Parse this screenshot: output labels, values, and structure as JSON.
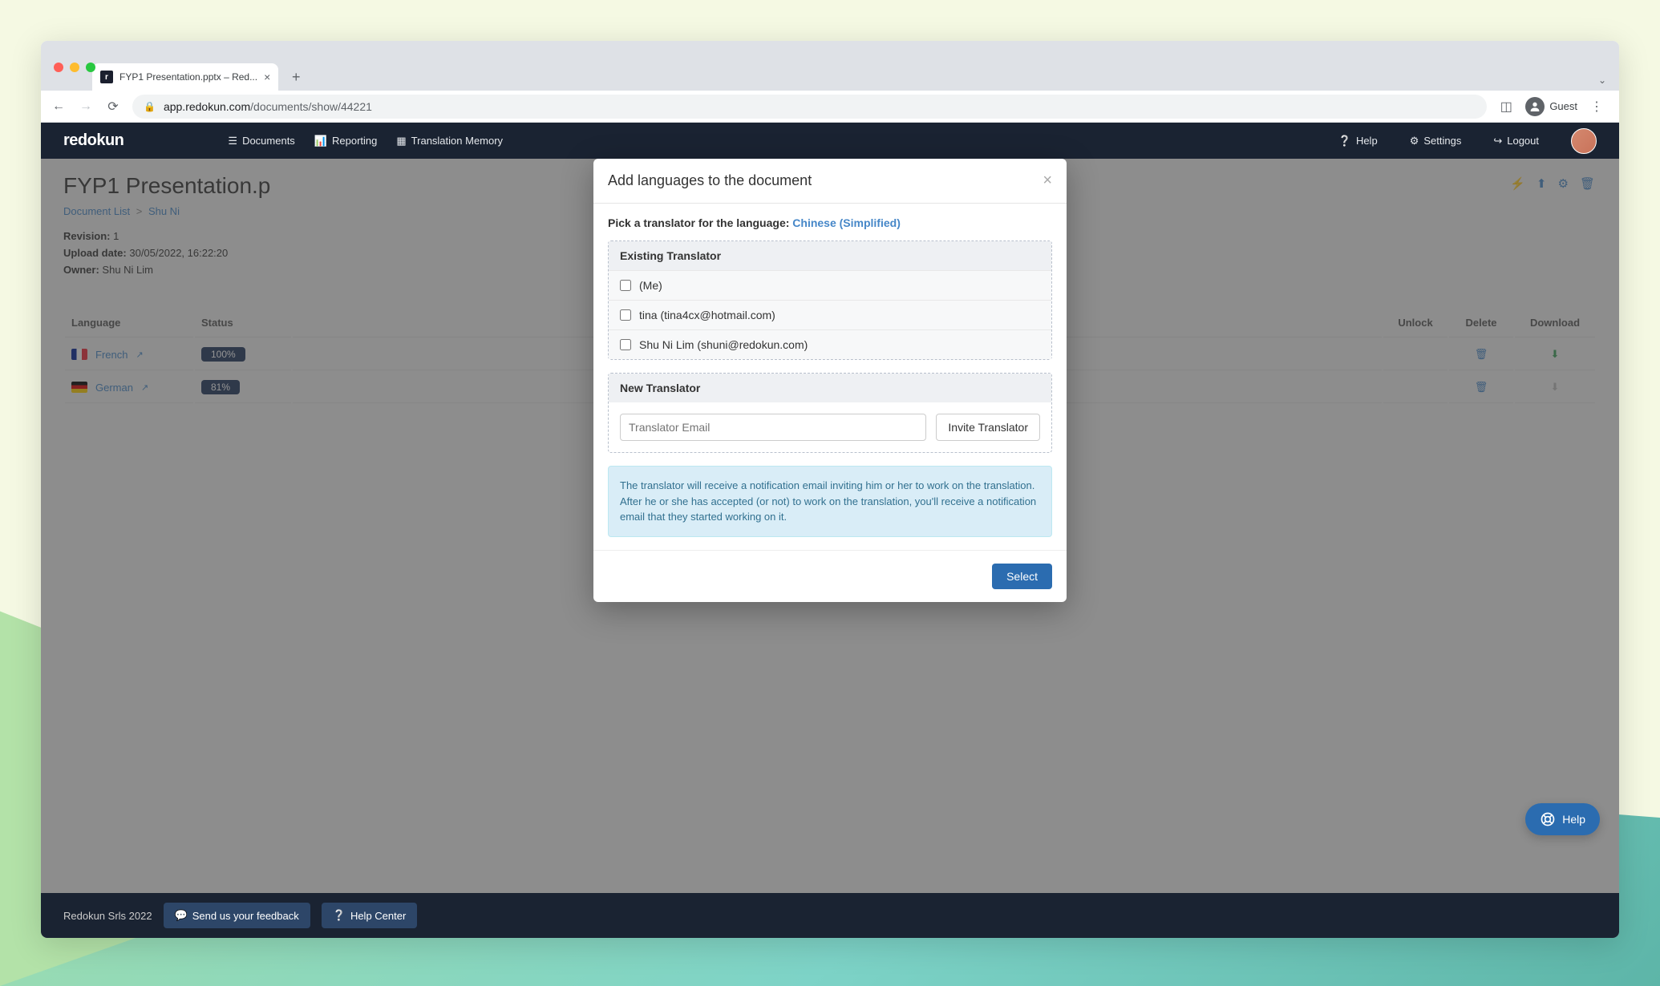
{
  "browser": {
    "tab_title": "FYP1 Presentation.pptx – Red...",
    "url_domain": "app.redokun.com",
    "url_path": "/documents/show/44221",
    "guest_label": "Guest"
  },
  "nav": {
    "brand": "redokun",
    "documents": "Documents",
    "reporting": "Reporting",
    "tm": "Translation Memory",
    "help": "Help",
    "settings": "Settings",
    "logout": "Logout"
  },
  "page": {
    "title": "FYP1 Presentation.p",
    "breadcrumb_list": "Document List",
    "breadcrumb_item": "Shu Ni",
    "revision_label": "Revision:",
    "revision_value": "1",
    "upload_label": "Upload date:",
    "upload_value": "30/05/2022, 16:22:20",
    "owner_label": "Owner:",
    "owner_value": "Shu Ni Lim"
  },
  "table": {
    "col_language": "Language",
    "col_status": "Status",
    "col_unlock": "Unlock",
    "col_delete": "Delete",
    "col_download": "Download",
    "rows": [
      {
        "language": "French",
        "status": "100%"
      },
      {
        "language": "German",
        "status": "81%"
      }
    ]
  },
  "modal": {
    "title": "Add languages to the document",
    "picker_prefix": "Pick a translator for the language:",
    "picker_language": "Chinese (Simplified)",
    "existing_header": "Existing Translator",
    "translators": [
      {
        "label": "(Me)"
      },
      {
        "label": "tina (tina4cx@hotmail.com)"
      },
      {
        "label": "Shu Ni Lim (shuni@redokun.com)"
      }
    ],
    "new_header": "New Translator",
    "email_placeholder": "Translator Email",
    "invite_label": "Invite Translator",
    "info_text1": "The translator will receive a notification email inviting him or her to work on the translation.",
    "info_text2": "After he or she has accepted (or not) to work on the translation, you'll receive a notification email that they started working on it.",
    "select_label": "Select"
  },
  "footer": {
    "copyright": "Redokun Srls 2022",
    "feedback": "Send us your feedback",
    "help_center": "Help Center"
  },
  "help_widget": "Help"
}
